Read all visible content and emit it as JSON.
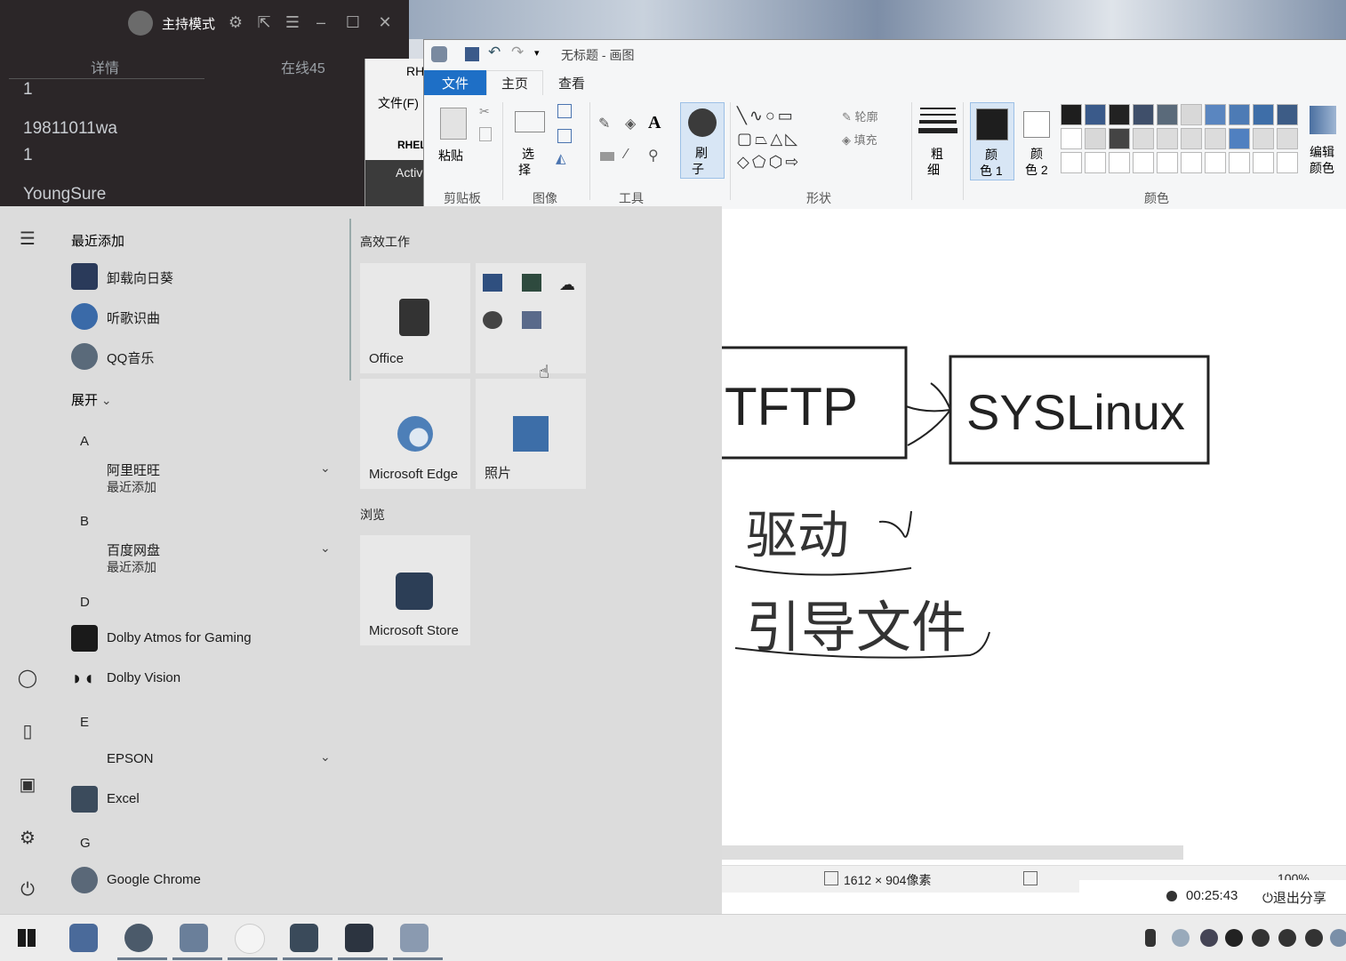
{
  "live_panel": {
    "mode_label": "主持模式",
    "tab_left": "详情",
    "tab_right": "在线45",
    "messages": [
      "1",
      "19811011wa",
      "1",
      "YoungSure"
    ]
  },
  "rhel_window": {
    "title": "RH",
    "menu": "文件(F)",
    "tab": "RHEL",
    "item": "Activ"
  },
  "paint": {
    "title": "无标题 - 画图",
    "tabs": {
      "file": "文件",
      "home": "主页",
      "view": "查看"
    },
    "groups": {
      "clipboard": "剪贴板",
      "image": "图像",
      "tools": "工具",
      "shapes": "形状",
      "colors": "颜色"
    },
    "buttons": {
      "paste": "粘贴",
      "select_1": "选",
      "select_2": "择",
      "brush_1": "刷",
      "brush_2": "子",
      "outline": "轮廓",
      "fill": "填充",
      "size_1": "粗",
      "size_2": "细",
      "color1_1": "颜",
      "color1_2": "色 1",
      "color2_1": "颜",
      "color2_2": "色 2",
      "edit_colors_1": "编辑",
      "edit_colors_2": "颜色"
    },
    "palette_row1": [
      "#1e1e1e",
      "#3a5a8a",
      "#222222",
      "#3f4f6a",
      "#5a6a7a",
      "#d8d8d8",
      "#5a86c0",
      "#4d7bb5",
      "#3e6ea8",
      "#3d5c86"
    ],
    "palette_row2": [
      "#ffffff",
      "#d8d8d8",
      "#444444",
      "#dcdcdc",
      "#dcdcdc",
      "#dcdcdc",
      "#dcdcdc",
      "#5080c0",
      "#dcdcdc",
      "#dcdcdc"
    ],
    "canvas_text": {
      "tftp": "TFTP",
      "syslinux": "SYSLinux",
      "driver": "驱动",
      "boot_file": "引导文件"
    },
    "status": {
      "size": "1612 × 904像素",
      "zoom": "100%"
    }
  },
  "share_bar": {
    "timer": "00:25:43",
    "exit": "退出分享"
  },
  "start_menu": {
    "recent_header": "最近添加",
    "recent": [
      "卸载向日葵",
      "听歌识曲",
      "QQ音乐"
    ],
    "expand": "展开",
    "sections": [
      {
        "letter": "A",
        "apps": [
          {
            "name": "阿里旺旺",
            "sub": "最近添加"
          }
        ]
      },
      {
        "letter": "B",
        "apps": [
          {
            "name": "百度网盘",
            "sub": "最近添加"
          }
        ]
      },
      {
        "letter": "D",
        "apps": [
          {
            "name": "Dolby Atmos for Gaming"
          },
          {
            "name": "Dolby Vision"
          }
        ]
      },
      {
        "letter": "E",
        "apps": [
          {
            "name": "EPSON"
          },
          {
            "name": "Excel"
          }
        ]
      },
      {
        "letter": "G",
        "apps": [
          {
            "name": "Google Chrome"
          }
        ]
      }
    ],
    "group_productive": "高效工作",
    "group_browse": "浏览",
    "tiles": {
      "office": "Office",
      "edge": "Microsoft Edge",
      "photos": "照片",
      "store": "Microsoft Store"
    }
  }
}
